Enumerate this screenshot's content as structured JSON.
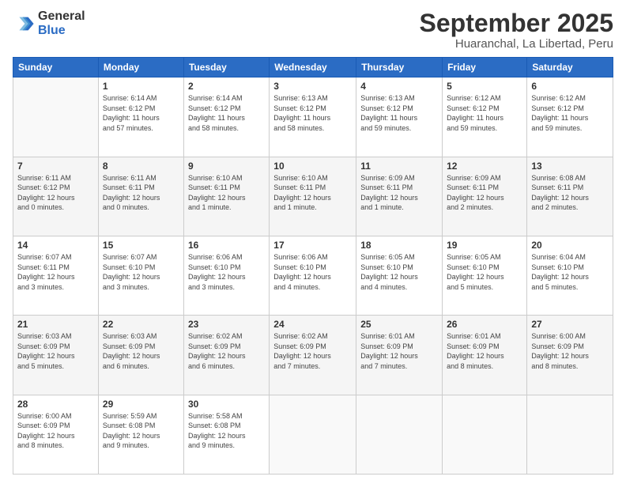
{
  "logo": {
    "line1": "General",
    "line2": "Blue"
  },
  "title": "September 2025",
  "subtitle": "Huaranchal, La Libertad, Peru",
  "days_of_week": [
    "Sunday",
    "Monday",
    "Tuesday",
    "Wednesday",
    "Thursday",
    "Friday",
    "Saturday"
  ],
  "weeks": [
    [
      {
        "day": "",
        "info": ""
      },
      {
        "day": "1",
        "info": "Sunrise: 6:14 AM\nSunset: 6:12 PM\nDaylight: 11 hours\nand 57 minutes."
      },
      {
        "day": "2",
        "info": "Sunrise: 6:14 AM\nSunset: 6:12 PM\nDaylight: 11 hours\nand 58 minutes."
      },
      {
        "day": "3",
        "info": "Sunrise: 6:13 AM\nSunset: 6:12 PM\nDaylight: 11 hours\nand 58 minutes."
      },
      {
        "day": "4",
        "info": "Sunrise: 6:13 AM\nSunset: 6:12 PM\nDaylight: 11 hours\nand 59 minutes."
      },
      {
        "day": "5",
        "info": "Sunrise: 6:12 AM\nSunset: 6:12 PM\nDaylight: 11 hours\nand 59 minutes."
      },
      {
        "day": "6",
        "info": "Sunrise: 6:12 AM\nSunset: 6:12 PM\nDaylight: 11 hours\nand 59 minutes."
      }
    ],
    [
      {
        "day": "7",
        "info": "Sunrise: 6:11 AM\nSunset: 6:12 PM\nDaylight: 12 hours\nand 0 minutes."
      },
      {
        "day": "8",
        "info": "Sunrise: 6:11 AM\nSunset: 6:11 PM\nDaylight: 12 hours\nand 0 minutes."
      },
      {
        "day": "9",
        "info": "Sunrise: 6:10 AM\nSunset: 6:11 PM\nDaylight: 12 hours\nand 1 minute."
      },
      {
        "day": "10",
        "info": "Sunrise: 6:10 AM\nSunset: 6:11 PM\nDaylight: 12 hours\nand 1 minute."
      },
      {
        "day": "11",
        "info": "Sunrise: 6:09 AM\nSunset: 6:11 PM\nDaylight: 12 hours\nand 1 minute."
      },
      {
        "day": "12",
        "info": "Sunrise: 6:09 AM\nSunset: 6:11 PM\nDaylight: 12 hours\nand 2 minutes."
      },
      {
        "day": "13",
        "info": "Sunrise: 6:08 AM\nSunset: 6:11 PM\nDaylight: 12 hours\nand 2 minutes."
      }
    ],
    [
      {
        "day": "14",
        "info": "Sunrise: 6:07 AM\nSunset: 6:11 PM\nDaylight: 12 hours\nand 3 minutes."
      },
      {
        "day": "15",
        "info": "Sunrise: 6:07 AM\nSunset: 6:10 PM\nDaylight: 12 hours\nand 3 minutes."
      },
      {
        "day": "16",
        "info": "Sunrise: 6:06 AM\nSunset: 6:10 PM\nDaylight: 12 hours\nand 3 minutes."
      },
      {
        "day": "17",
        "info": "Sunrise: 6:06 AM\nSunset: 6:10 PM\nDaylight: 12 hours\nand 4 minutes."
      },
      {
        "day": "18",
        "info": "Sunrise: 6:05 AM\nSunset: 6:10 PM\nDaylight: 12 hours\nand 4 minutes."
      },
      {
        "day": "19",
        "info": "Sunrise: 6:05 AM\nSunset: 6:10 PM\nDaylight: 12 hours\nand 5 minutes."
      },
      {
        "day": "20",
        "info": "Sunrise: 6:04 AM\nSunset: 6:10 PM\nDaylight: 12 hours\nand 5 minutes."
      }
    ],
    [
      {
        "day": "21",
        "info": "Sunrise: 6:03 AM\nSunset: 6:09 PM\nDaylight: 12 hours\nand 5 minutes."
      },
      {
        "day": "22",
        "info": "Sunrise: 6:03 AM\nSunset: 6:09 PM\nDaylight: 12 hours\nand 6 minutes."
      },
      {
        "day": "23",
        "info": "Sunrise: 6:02 AM\nSunset: 6:09 PM\nDaylight: 12 hours\nand 6 minutes."
      },
      {
        "day": "24",
        "info": "Sunrise: 6:02 AM\nSunset: 6:09 PM\nDaylight: 12 hours\nand 7 minutes."
      },
      {
        "day": "25",
        "info": "Sunrise: 6:01 AM\nSunset: 6:09 PM\nDaylight: 12 hours\nand 7 minutes."
      },
      {
        "day": "26",
        "info": "Sunrise: 6:01 AM\nSunset: 6:09 PM\nDaylight: 12 hours\nand 8 minutes."
      },
      {
        "day": "27",
        "info": "Sunrise: 6:00 AM\nSunset: 6:09 PM\nDaylight: 12 hours\nand 8 minutes."
      }
    ],
    [
      {
        "day": "28",
        "info": "Sunrise: 6:00 AM\nSunset: 6:09 PM\nDaylight: 12 hours\nand 8 minutes."
      },
      {
        "day": "29",
        "info": "Sunrise: 5:59 AM\nSunset: 6:08 PM\nDaylight: 12 hours\nand 9 minutes."
      },
      {
        "day": "30",
        "info": "Sunrise: 5:58 AM\nSunset: 6:08 PM\nDaylight: 12 hours\nand 9 minutes."
      },
      {
        "day": "",
        "info": ""
      },
      {
        "day": "",
        "info": ""
      },
      {
        "day": "",
        "info": ""
      },
      {
        "day": "",
        "info": ""
      }
    ]
  ]
}
